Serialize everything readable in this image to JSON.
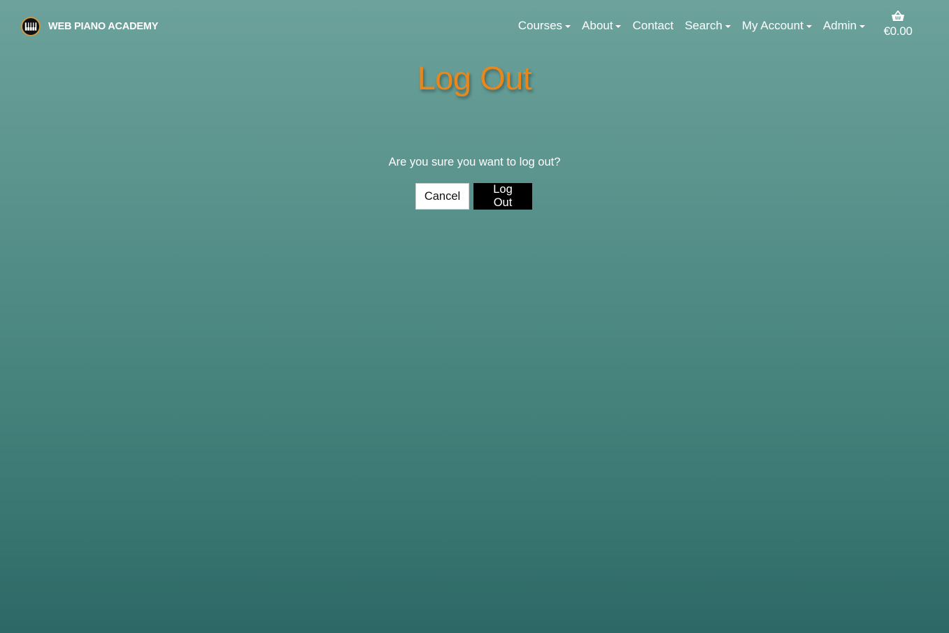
{
  "brand": {
    "name": "WEB PIANO ACADEMY",
    "logo_icon": "piano-keys-icon"
  },
  "nav": {
    "items": [
      {
        "label": "Courses",
        "dropdown": true
      },
      {
        "label": "About",
        "dropdown": true
      },
      {
        "label": "Contact",
        "dropdown": false
      },
      {
        "label": "Search",
        "dropdown": true
      },
      {
        "label": "My Account",
        "dropdown": true
      },
      {
        "label": "Admin",
        "dropdown": true
      }
    ],
    "cart": {
      "icon": "basket-icon",
      "total": "€0.00"
    }
  },
  "main": {
    "title": "Log Out",
    "question": "Are you sure you want to log out?",
    "cancel_label": "Cancel",
    "logout_label": "Log Out"
  },
  "colors": {
    "title": "#e8881c",
    "background_top": "#6ca29b",
    "background_bottom": "#2d6866",
    "logout_button": "#000000",
    "cancel_button": "#ffffff"
  }
}
